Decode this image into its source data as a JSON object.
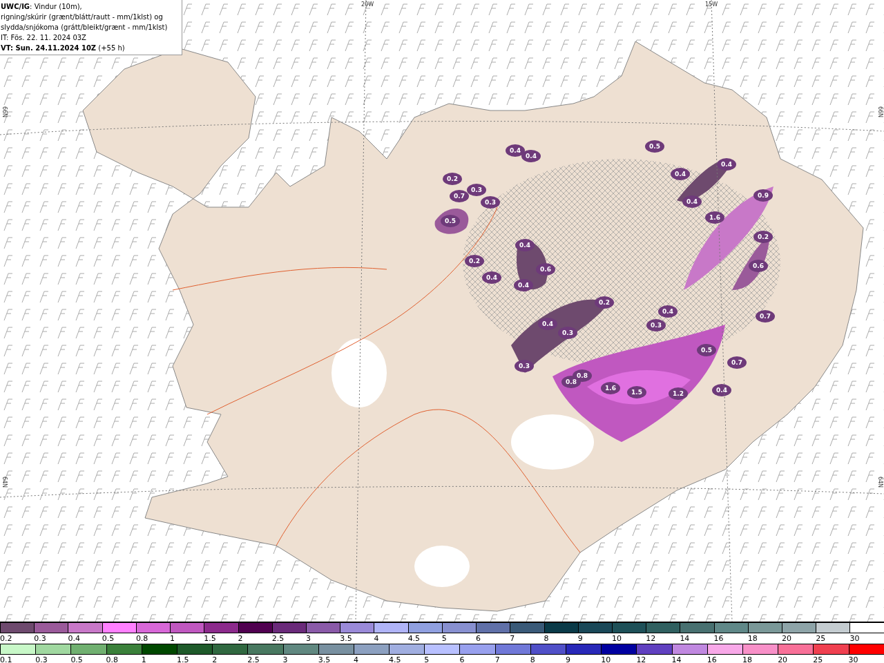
{
  "title_box": {
    "lines": [
      "**UWC/IG**: Vindur (10m),",
      "rigning/skúrir (grænt/blátt/rautt - mm/1klst) og",
      "slydda/snjókoma (grátt/bleikt/grænt - mm/1klst)",
      "IT: Fös. 22. 11. 2024 03Z",
      "**VT: Sun. 24.11.2024 10Z** (+55 h)"
    ]
  },
  "map": {
    "grid_labels": [
      "20W",
      "15W",
      "66N",
      "64N",
      "66N",
      "64N"
    ],
    "value_labels": [
      "0.4",
      "0.4",
      "0.5",
      "0.4",
      "0.4",
      "0.2",
      "0.3",
      "0.7",
      "0.3",
      "0.5",
      "0.4",
      "0.9",
      "1.6",
      "0.2",
      "0.4",
      "0.6",
      "0.2",
      "0.4",
      "0.4",
      "0.6",
      "0.2",
      "0.4",
      "0.3",
      "0.4",
      "0.3",
      "0.7",
      "0.5",
      "0.7",
      "0.3",
      "0.8",
      "0.8",
      "1.6",
      "1.5",
      "1.2",
      "0.4"
    ]
  },
  "legends": [
    {
      "items": [
        {
          "label": "0.2",
          "color": "#6e4a6e"
        },
        {
          "label": "0.3",
          "color": "#9a5a9a"
        },
        {
          "label": "0.4",
          "color": "#c878c8"
        },
        {
          "label": "0.5",
          "color": "#ff80ff"
        },
        {
          "label": "0.8",
          "color": "#d868d8"
        },
        {
          "label": "1",
          "color": "#c058c0"
        },
        {
          "label": "1.5",
          "color": "#8c2a8c"
        },
        {
          "label": "2",
          "color": "#500050"
        },
        {
          "label": "2.5",
          "color": "#6a2a7a"
        },
        {
          "label": "3",
          "color": "#8a5aa8"
        },
        {
          "label": "3.5",
          "color": "#9a8ad8"
        },
        {
          "label": "4",
          "color": "#b0b4f8"
        },
        {
          "label": "4.5",
          "color": "#90a0e0"
        },
        {
          "label": "5",
          "color": "#8890d0"
        },
        {
          "label": "6",
          "color": "#6070a8"
        },
        {
          "label": "7",
          "color": "#3a5a78"
        },
        {
          "label": "8",
          "color": "#0a3a48"
        },
        {
          "label": "9",
          "color": "#1a4858"
        },
        {
          "label": "10",
          "color": "#1e5058"
        },
        {
          "label": "12",
          "color": "#306060"
        },
        {
          "label": "14",
          "color": "#487070"
        },
        {
          "label": "16",
          "color": "#608888"
        },
        {
          "label": "18",
          "color": "#7a9898"
        },
        {
          "label": "20",
          "color": "#8ea4a8"
        },
        {
          "label": "25",
          "color": "#c4ccd0"
        },
        {
          "label": "30",
          "color": "#ffffff"
        }
      ]
    },
    {
      "items": [
        {
          "label": "0.1",
          "color": "#c8f8c8"
        },
        {
          "label": "0.3",
          "color": "#a0d8a0"
        },
        {
          "label": "0.5",
          "color": "#70b070"
        },
        {
          "label": "0.8",
          "color": "#3a803a"
        },
        {
          "label": "1",
          "color": "#004800"
        },
        {
          "label": "1.5",
          "color": "#1e5a2a"
        },
        {
          "label": "2",
          "color": "#306840"
        },
        {
          "label": "2.5",
          "color": "#487860"
        },
        {
          "label": "3",
          "color": "#608880"
        },
        {
          "label": "3.5",
          "color": "#7890a0"
        },
        {
          "label": "4",
          "color": "#8ca0c0"
        },
        {
          "label": "4.5",
          "color": "#a0aee0"
        },
        {
          "label": "5",
          "color": "#b8c0ff"
        },
        {
          "label": "6",
          "color": "#98a0ee"
        },
        {
          "label": "7",
          "color": "#7078d8"
        },
        {
          "label": "8",
          "color": "#5050c8"
        },
        {
          "label": "9",
          "color": "#2828b8"
        },
        {
          "label": "10",
          "color": "#0000a0"
        },
        {
          "label": "12",
          "color": "#6040c0"
        },
        {
          "label": "14",
          "color": "#c088e0"
        },
        {
          "label": "16",
          "color": "#f8a8e8"
        },
        {
          "label": "18",
          "color": "#f890c8"
        },
        {
          "label": "20",
          "color": "#f87098"
        },
        {
          "label": "25",
          "color": "#f04050"
        },
        {
          "label": "30",
          "color": "#ff0000"
        }
      ]
    }
  ]
}
